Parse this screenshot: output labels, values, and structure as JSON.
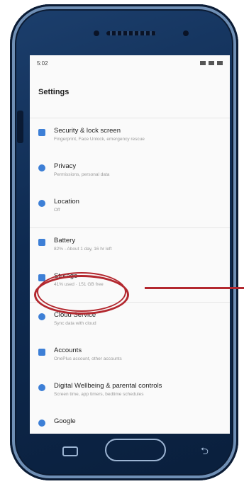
{
  "status": {
    "time": "5:02"
  },
  "title": "Settings",
  "items": [
    {
      "label": "Security & lock screen",
      "sub": "Fingerprint, Face Unlock, emergency rescue",
      "icon": "lock-icon"
    },
    {
      "label": "Privacy",
      "sub": "Permissions, personal data",
      "icon": "privacy-icon"
    },
    {
      "label": "Location",
      "sub": "Off",
      "icon": "location-icon"
    },
    {
      "label": "Battery",
      "sub": "82% - About 1 day, 16 hr left",
      "icon": "battery-icon"
    },
    {
      "label": "Storage",
      "sub": "41% used · 151 GB free",
      "icon": "storage-icon"
    },
    {
      "label": "Cloud Service",
      "sub": "Sync data with cloud",
      "icon": "cloud-icon"
    },
    {
      "label": "Accounts",
      "sub": "OnePlus account, other accounts",
      "icon": "accounts-icon"
    },
    {
      "label": "Digital Wellbeing & parental controls",
      "sub": "Screen time, app timers, bedtime schedules",
      "icon": "wellbeing-icon"
    },
    {
      "label": "Google",
      "sub": "",
      "icon": "google-icon"
    }
  ]
}
